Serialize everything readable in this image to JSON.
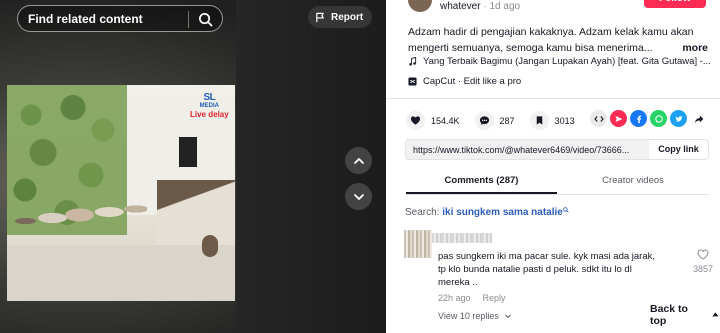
{
  "search": {
    "placeholder": "Find related content"
  },
  "video": {
    "report_label": "Report",
    "overlay_logo_top": "SL",
    "overlay_logo_mid": "MEDIA",
    "overlay_logo_tag": "Live delay"
  },
  "author": {
    "name": "whatever",
    "separator": "·",
    "posted": "1d ago",
    "follow_label": "Follow"
  },
  "caption": {
    "line1": "Adzam hadir di pengajian kakaknya. Adzam kelak kamu akan",
    "line2": "mengerti semuanya, semoga kamu bisa menerima...",
    "more": "more"
  },
  "music": {
    "title": "Yang Terbaik Bagimu (Jangan Lupakan Ayah) [feat. Gita Gutawa] -..."
  },
  "capcut": {
    "label": "CapCut · Edit like a pro"
  },
  "stats": {
    "likes": "154.4K",
    "comments": "287",
    "saves": "3013"
  },
  "share_icons": [
    "embed-icon",
    "send-icon",
    "facebook-icon",
    "whatsapp-icon",
    "twitter-icon",
    "share-arrow-icon"
  ],
  "link": {
    "url": "https://www.tiktok.com/@whatever6469/video/73666...",
    "copy_label": "Copy link"
  },
  "tabs": [
    {
      "label": "Comments (287)",
      "active": true
    },
    {
      "label": "Creator videos",
      "active": false
    }
  ],
  "search_suggest": {
    "prefix": "Search: ",
    "query": "iki sungkem sama natalie"
  },
  "comment": {
    "text_line1": "pas sungkem iki ma pacar sule. kyk masi ada jarak,",
    "text_line2": "tp klo bunda natalie pasti d peluk. sdkt itu lo dl",
    "text_line3": "mereka ..",
    "likes": "3857",
    "time": "22h ago",
    "reply_label": "Reply",
    "view_replies": "View 10 replies"
  },
  "back_to_top": "Back to top",
  "colors": {
    "accent": "#fe2c55",
    "link": "#2b5db9",
    "text": "#161823",
    "muted": "#8a8b91"
  }
}
